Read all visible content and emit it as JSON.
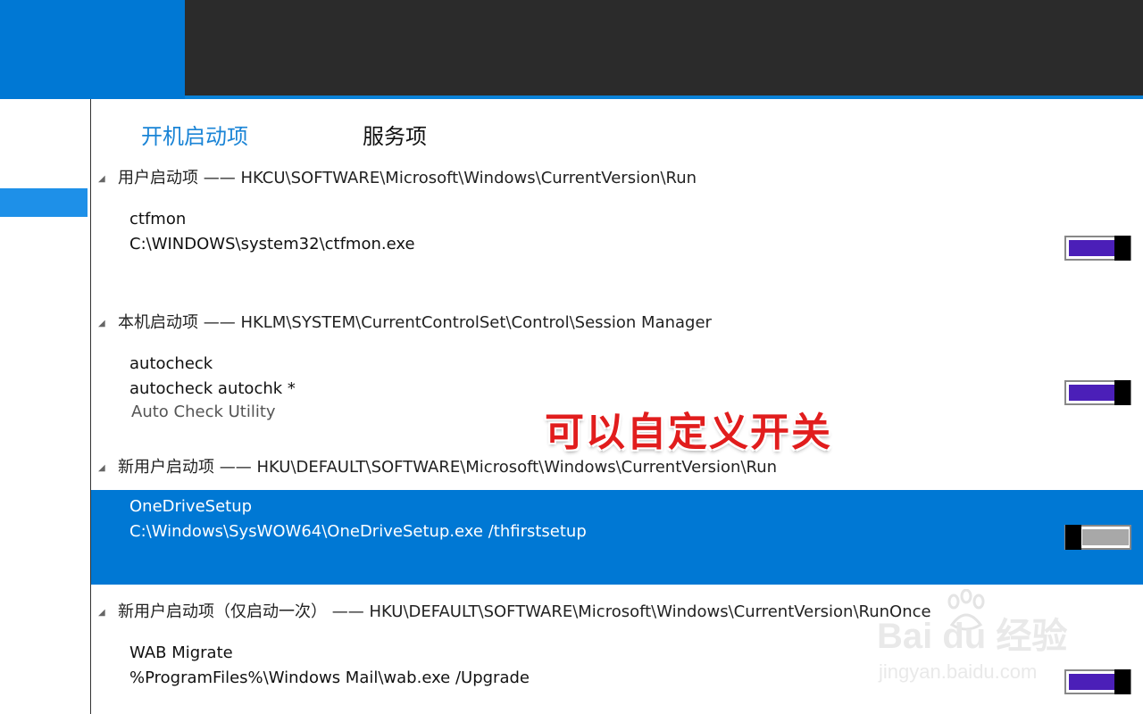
{
  "tabs": {
    "startup": "开机启动项",
    "services": "服务项"
  },
  "groups": [
    {
      "header": "用户启动项 —— HKCU\\SOFTWARE\\Microsoft\\Windows\\CurrentVersion\\Run",
      "item": {
        "name": "ctfmon",
        "path": "C:\\WINDOWS\\system32\\ctfmon.exe",
        "enabled": true
      }
    },
    {
      "header": "本机启动项 —— HKLM\\SYSTEM\\CurrentControlSet\\Control\\Session Manager",
      "item": {
        "name": "autocheck",
        "path": "autocheck autochk *",
        "description": "Auto Check Utility",
        "enabled": true
      }
    },
    {
      "header": "新用户启动项 —— HKU\\DEFAULT\\SOFTWARE\\Microsoft\\Windows\\CurrentVersion\\Run",
      "item": {
        "name": "OneDriveSetup",
        "path": "C:\\Windows\\SysWOW64\\OneDriveSetup.exe /thfirstsetup",
        "enabled": false,
        "selected": true
      }
    },
    {
      "header": "新用户启动项（仅启动一次） —— HKU\\DEFAULT\\SOFTWARE\\Microsoft\\Windows\\CurrentVersion\\RunOnce",
      "item": {
        "name": "WAB Migrate",
        "path": "%ProgramFiles%\\Windows Mail\\wab.exe /Upgrade",
        "enabled": true
      }
    }
  ],
  "annotation": "可以自定义开关",
  "watermark": {
    "logo": "Bai  du 经验",
    "url": "jingyan.baidu.com"
  },
  "colors": {
    "accent": "#0078d4",
    "toggle_on": "#4b1fb8",
    "toggle_off": "#a8a8a8",
    "annotation": "#e11d1d"
  }
}
